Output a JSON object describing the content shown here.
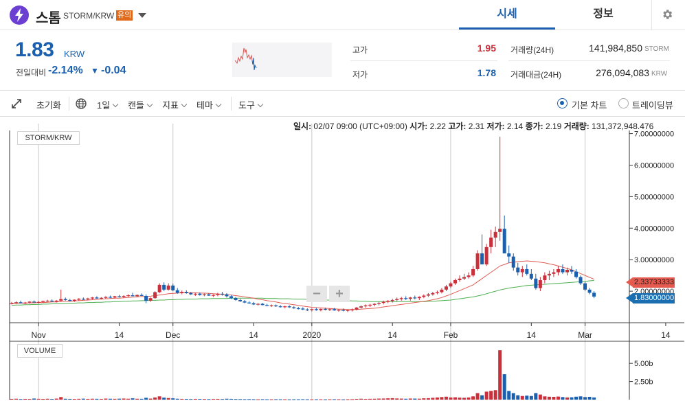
{
  "coin": {
    "name": "스톰",
    "pair": "STORM/KRW",
    "warning_badge": "유의"
  },
  "tabs": {
    "price": "시세",
    "info": "정보"
  },
  "summary": {
    "price": "1.83",
    "price_unit": "KRW",
    "change_label": "전일대비",
    "change_rate": "-2.14%",
    "change_arrow": "▼",
    "change_amount": "-0.04",
    "high_label": "고가",
    "high_value": "1.95",
    "low_label": "저가",
    "low_value": "1.78",
    "volume_label": "거래량(24H)",
    "volume_value": "141,984,850",
    "volume_unit": "STORM",
    "amount_label": "거래대금(24H)",
    "amount_value": "276,094,083",
    "amount_unit": "KRW"
  },
  "toolbar": {
    "reset": "초기화",
    "interval": "1일",
    "candle": "캔들",
    "indicator": "지표",
    "theme": "테마",
    "tools": "도구",
    "basic_chart": "기본 차트",
    "trading_view": "트레이딩뷰"
  },
  "ohlc": {
    "time_label": "일시:",
    "time_value": "02/07 09:00 (UTC+09:00)",
    "open_label": "시가:",
    "open_value": "2.22",
    "high_label": "고가:",
    "high_value": "2.31",
    "low_label": "저가:",
    "low_value": "2.14",
    "close_label": "종가:",
    "close_value": "2.19",
    "volume_label": "거래량:",
    "volume_value": "131,372,948.476"
  },
  "chart_labels": {
    "pair_label": "STORM/KRW",
    "volume_label": "VOLUME",
    "zoom_out": "−",
    "zoom_in": "+",
    "ma_tag": "2.33733333",
    "price_tag": "1.83000000"
  },
  "chart_data": {
    "type": "candlestick",
    "y_ticks": [
      "7.00000000",
      "6.00000000",
      "5.00000000",
      "4.00000000",
      "3.00000000",
      "2.00000000"
    ],
    "y_tick_values": [
      7,
      6,
      5,
      4,
      3,
      2
    ],
    "ylim": [
      1.0,
      7.1
    ],
    "x_tick_labels": [
      "Nov",
      "14",
      "Dec",
      "14",
      "2020",
      "14",
      "Feb",
      "14",
      "Mar",
      "14"
    ],
    "x_tick_days": [
      6,
      24,
      36,
      54,
      67,
      85,
      98,
      116,
      128,
      146
    ],
    "volume_ticks": [
      "5.00b",
      "2.50b"
    ],
    "volume_tick_values": [
      5.0,
      2.5
    ],
    "colors": {
      "up": "#c8303b",
      "down": "#1b5faf",
      "ma_short": "#e05b52",
      "ma_long": "#4caf50"
    },
    "candles": [
      [
        1.61,
        1.66,
        1.58,
        1.63
      ],
      [
        1.63,
        1.68,
        1.6,
        1.65
      ],
      [
        1.65,
        1.7,
        1.62,
        1.62
      ],
      [
        1.62,
        1.66,
        1.59,
        1.64
      ],
      [
        1.64,
        1.68,
        1.61,
        1.67
      ],
      [
        1.67,
        1.71,
        1.64,
        1.64
      ],
      [
        1.64,
        1.69,
        1.61,
        1.66
      ],
      [
        1.66,
        1.7,
        1.63,
        1.69
      ],
      [
        1.69,
        1.73,
        1.66,
        1.7
      ],
      [
        1.7,
        1.74,
        1.66,
        1.67
      ],
      [
        1.67,
        1.72,
        1.64,
        1.7
      ],
      [
        1.7,
        2.05,
        1.67,
        1.75
      ],
      [
        1.75,
        1.8,
        1.7,
        1.72
      ],
      [
        1.72,
        1.76,
        1.68,
        1.69
      ],
      [
        1.69,
        1.74,
        1.66,
        1.73
      ],
      [
        1.73,
        1.78,
        1.7,
        1.76
      ],
      [
        1.76,
        1.8,
        1.72,
        1.74
      ],
      [
        1.74,
        1.79,
        1.71,
        1.77
      ],
      [
        1.77,
        1.82,
        1.74,
        1.8
      ],
      [
        1.8,
        1.84,
        1.76,
        1.77
      ],
      [
        1.77,
        1.81,
        1.74,
        1.79
      ],
      [
        1.79,
        1.84,
        1.76,
        1.82
      ],
      [
        1.82,
        1.86,
        1.78,
        1.8
      ],
      [
        1.8,
        1.85,
        1.77,
        1.84
      ],
      [
        1.84,
        1.88,
        1.8,
        1.82
      ],
      [
        1.82,
        1.87,
        1.79,
        1.85
      ],
      [
        1.85,
        1.9,
        1.82,
        1.87
      ],
      [
        1.87,
        1.95,
        1.84,
        1.84
      ],
      [
        1.84,
        1.9,
        1.81,
        1.88
      ],
      [
        1.88,
        1.93,
        1.85,
        1.85
      ],
      [
        1.85,
        1.9,
        1.62,
        1.7
      ],
      [
        1.7,
        1.8,
        1.66,
        1.78
      ],
      [
        1.78,
        2.0,
        1.76,
        1.97
      ],
      [
        1.97,
        2.25,
        1.94,
        2.2
      ],
      [
        2.2,
        2.28,
        2.0,
        2.05
      ],
      [
        2.05,
        2.25,
        2.02,
        2.18
      ],
      [
        2.18,
        2.24,
        2.0,
        2.03
      ],
      [
        2.03,
        2.1,
        1.92,
        1.95
      ],
      [
        1.95,
        2.02,
        1.9,
        1.98
      ],
      [
        1.98,
        2.03,
        1.92,
        1.94
      ],
      [
        1.94,
        1.98,
        1.88,
        1.9
      ],
      [
        1.9,
        1.95,
        1.85,
        1.92
      ],
      [
        1.92,
        1.96,
        1.86,
        1.88
      ],
      [
        1.88,
        1.93,
        1.84,
        1.9
      ],
      [
        1.9,
        1.94,
        1.85,
        1.86
      ],
      [
        1.86,
        1.9,
        1.82,
        1.88
      ],
      [
        1.88,
        1.95,
        1.84,
        1.92
      ],
      [
        1.92,
        1.98,
        1.86,
        1.9
      ],
      [
        1.9,
        1.94,
        1.8,
        1.84
      ],
      [
        1.84,
        1.88,
        1.75,
        1.78
      ],
      [
        1.78,
        1.82,
        1.7,
        1.72
      ],
      [
        1.72,
        1.76,
        1.66,
        1.68
      ],
      [
        1.68,
        1.72,
        1.62,
        1.64
      ],
      [
        1.64,
        1.68,
        1.6,
        1.62
      ],
      [
        1.62,
        1.66,
        1.56,
        1.58
      ],
      [
        1.58,
        1.62,
        1.54,
        1.6
      ],
      [
        1.6,
        1.63,
        1.55,
        1.56
      ],
      [
        1.56,
        1.6,
        1.52,
        1.54
      ],
      [
        1.54,
        1.58,
        1.5,
        1.55
      ],
      [
        1.55,
        1.58,
        1.5,
        1.52
      ],
      [
        1.52,
        1.56,
        1.48,
        1.5
      ],
      [
        1.5,
        1.54,
        1.46,
        1.52
      ],
      [
        1.52,
        1.55,
        1.47,
        1.49
      ],
      [
        1.49,
        1.53,
        1.44,
        1.46
      ],
      [
        1.46,
        1.5,
        1.42,
        1.45
      ],
      [
        1.45,
        1.49,
        1.4,
        1.42
      ],
      [
        1.42,
        1.46,
        1.37,
        1.4
      ],
      [
        1.4,
        1.45,
        1.36,
        1.43
      ],
      [
        1.43,
        1.47,
        1.38,
        1.4
      ],
      [
        1.4,
        1.45,
        1.36,
        1.44
      ],
      [
        1.44,
        1.48,
        1.39,
        1.41
      ],
      [
        1.41,
        1.45,
        1.37,
        1.43
      ],
      [
        1.43,
        1.47,
        1.38,
        1.39
      ],
      [
        1.39,
        1.43,
        1.35,
        1.41
      ],
      [
        1.41,
        1.45,
        1.36,
        1.38
      ],
      [
        1.38,
        1.42,
        1.34,
        1.4
      ],
      [
        1.4,
        1.45,
        1.36,
        1.42
      ],
      [
        1.42,
        1.5,
        1.39,
        1.48
      ],
      [
        1.48,
        1.55,
        1.45,
        1.52
      ],
      [
        1.52,
        1.58,
        1.48,
        1.55
      ],
      [
        1.55,
        1.6,
        1.5,
        1.57
      ],
      [
        1.57,
        1.62,
        1.52,
        1.6
      ],
      [
        1.6,
        1.66,
        1.55,
        1.63
      ],
      [
        1.63,
        1.7,
        1.58,
        1.66
      ],
      [
        1.66,
        1.72,
        1.62,
        1.69
      ],
      [
        1.69,
        1.76,
        1.64,
        1.72
      ],
      [
        1.72,
        1.8,
        1.68,
        1.75
      ],
      [
        1.75,
        1.82,
        1.7,
        1.78
      ],
      [
        1.78,
        1.84,
        1.72,
        1.76
      ],
      [
        1.76,
        1.82,
        1.7,
        1.8
      ],
      [
        1.8,
        1.86,
        1.74,
        1.78
      ],
      [
        1.78,
        1.84,
        1.72,
        1.82
      ],
      [
        1.82,
        1.9,
        1.78,
        1.86
      ],
      [
        1.86,
        1.94,
        1.82,
        1.9
      ],
      [
        1.9,
        1.98,
        1.86,
        1.94
      ],
      [
        1.94,
        2.02,
        1.9,
        1.97
      ],
      [
        1.97,
        2.1,
        1.93,
        2.05
      ],
      [
        2.05,
        2.2,
        2.0,
        2.15
      ],
      [
        2.15,
        2.3,
        2.1,
        2.25
      ],
      [
        2.25,
        2.4,
        2.2,
        2.35
      ],
      [
        2.35,
        2.5,
        2.3,
        2.4
      ],
      [
        2.4,
        2.55,
        2.35,
        2.45
      ],
      [
        2.45,
        2.6,
        2.4,
        2.5
      ],
      [
        2.5,
        2.8,
        2.45,
        2.7
      ],
      [
        2.7,
        3.3,
        2.65,
        3.2
      ],
      [
        3.2,
        3.8,
        2.9,
        2.85
      ],
      [
        2.85,
        3.5,
        2.8,
        3.4
      ],
      [
        3.4,
        3.95,
        3.2,
        3.7
      ],
      [
        3.7,
        4.05,
        3.4,
        3.88
      ],
      [
        3.88,
        6.9,
        3.6,
        3.98
      ],
      [
        3.98,
        4.4,
        3.2,
        3.2
      ],
      [
        3.2,
        3.45,
        2.9,
        3.1
      ],
      [
        3.1,
        3.2,
        2.65,
        2.75
      ],
      [
        2.75,
        2.9,
        2.5,
        2.6
      ],
      [
        2.6,
        2.8,
        2.45,
        2.7
      ],
      [
        2.7,
        2.85,
        2.5,
        2.55
      ],
      [
        2.55,
        2.7,
        2.35,
        2.4
      ],
      [
        2.4,
        2.55,
        2.05,
        2.1
      ],
      [
        2.1,
        2.45,
        2.0,
        2.35
      ],
      [
        2.35,
        2.6,
        2.25,
        2.5
      ],
      [
        2.5,
        2.65,
        2.35,
        2.55
      ],
      [
        2.55,
        2.7,
        2.45,
        2.6
      ],
      [
        2.6,
        2.8,
        2.5,
        2.7
      ],
      [
        2.7,
        2.85,
        2.55,
        2.6
      ],
      [
        2.6,
        2.75,
        2.5,
        2.68
      ],
      [
        2.68,
        2.8,
        2.55,
        2.62
      ],
      [
        2.62,
        2.7,
        2.4,
        2.45
      ],
      [
        2.45,
        2.5,
        2.2,
        2.25
      ],
      [
        2.25,
        2.3,
        2.0,
        2.05
      ],
      [
        2.05,
        2.1,
        1.9,
        1.95
      ],
      [
        1.95,
        2.0,
        1.78,
        1.83
      ]
    ],
    "volume": [
      0.1,
      0.12,
      0.08,
      0.1,
      0.09,
      0.15,
      0.11,
      0.1,
      0.12,
      0.09,
      0.14,
      0.35,
      0.12,
      0.1,
      0.09,
      0.11,
      0.13,
      0.1,
      0.12,
      0.11,
      0.1,
      0.14,
      0.12,
      0.11,
      0.13,
      0.15,
      0.12,
      0.18,
      0.12,
      0.11,
      0.25,
      0.14,
      0.3,
      0.45,
      0.28,
      0.22,
      0.18,
      0.12,
      0.1,
      0.09,
      0.08,
      0.1,
      0.09,
      0.08,
      0.07,
      0.09,
      0.1,
      0.08,
      0.12,
      0.1,
      0.08,
      0.07,
      0.06,
      0.07,
      0.06,
      0.05,
      0.06,
      0.05,
      0.05,
      0.06,
      0.05,
      0.05,
      0.04,
      0.05,
      0.05,
      0.06,
      0.05,
      0.04,
      0.05,
      0.05,
      0.04,
      0.05,
      0.06,
      0.05,
      0.04,
      0.05,
      0.06,
      0.1,
      0.12,
      0.1,
      0.11,
      0.12,
      0.14,
      0.15,
      0.18,
      0.2,
      0.16,
      0.14,
      0.12,
      0.15,
      0.14,
      0.13,
      0.18,
      0.2,
      0.25,
      0.3,
      0.35,
      0.4,
      0.3,
      0.32,
      0.28,
      0.25,
      0.3,
      0.45,
      0.9,
      0.6,
      1.1,
      1.2,
      1.3,
      6.8,
      3.5,
      1.2,
      0.9,
      0.6,
      0.5,
      0.55,
      0.5,
      0.9,
      0.7,
      0.45,
      0.4,
      0.38,
      0.42,
      0.35,
      0.3,
      0.32,
      0.4,
      0.45,
      0.35,
      0.38,
      0.3
    ],
    "ma_short": [
      1.6,
      1.61,
      1.62,
      1.62,
      1.63,
      1.63,
      1.64,
      1.64,
      1.65,
      1.66,
      1.66,
      1.67,
      1.68,
      1.68,
      1.69,
      1.7,
      1.71,
      1.72,
      1.73,
      1.74,
      1.75,
      1.76,
      1.77,
      1.78,
      1.78,
      1.79,
      1.8,
      1.81,
      1.82,
      1.83,
      1.83,
      1.84,
      1.86,
      1.88,
      1.9,
      1.92,
      1.93,
      1.94,
      1.95,
      1.95,
      1.95,
      1.95,
      1.94,
      1.94,
      1.93,
      1.92,
      1.91,
      1.9,
      1.89,
      1.88,
      1.86,
      1.84,
      1.82,
      1.8,
      1.78,
      1.75,
      1.73,
      1.7,
      1.68,
      1.66,
      1.63,
      1.61,
      1.59,
      1.57,
      1.55,
      1.53,
      1.51,
      1.49,
      1.48,
      1.47,
      1.46,
      1.45,
      1.44,
      1.43,
      1.43,
      1.42,
      1.42,
      1.42,
      1.43,
      1.44,
      1.45,
      1.46,
      1.48,
      1.5,
      1.52,
      1.54,
      1.56,
      1.58,
      1.6,
      1.62,
      1.64,
      1.66,
      1.68,
      1.7,
      1.73,
      1.76,
      1.8,
      1.85,
      1.9,
      1.96,
      2.02,
      2.08,
      2.14,
      2.2,
      2.3,
      2.4,
      2.5,
      2.6,
      2.7,
      2.8,
      2.85,
      2.9,
      2.92,
      2.94,
      2.95,
      2.96,
      2.95,
      2.94,
      2.92,
      2.9,
      2.87,
      2.84,
      2.8,
      2.76,
      2.72,
      2.68,
      2.62,
      2.56,
      2.5,
      2.44,
      2.38
    ],
    "ma_long": [
      1.55,
      1.56,
      1.56,
      1.57,
      1.57,
      1.58,
      1.58,
      1.59,
      1.59,
      1.6,
      1.6,
      1.61,
      1.61,
      1.62,
      1.62,
      1.63,
      1.63,
      1.64,
      1.64,
      1.65,
      1.65,
      1.66,
      1.66,
      1.67,
      1.67,
      1.68,
      1.68,
      1.69,
      1.69,
      1.7,
      1.7,
      1.71,
      1.71,
      1.72,
      1.72,
      1.73,
      1.73,
      1.74,
      1.74,
      1.75,
      1.75,
      1.75,
      1.76,
      1.76,
      1.76,
      1.77,
      1.77,
      1.77,
      1.77,
      1.78,
      1.78,
      1.78,
      1.78,
      1.78,
      1.78,
      1.78,
      1.78,
      1.77,
      1.77,
      1.77,
      1.76,
      1.76,
      1.76,
      1.75,
      1.75,
      1.75,
      1.74,
      1.74,
      1.73,
      1.73,
      1.72,
      1.72,
      1.71,
      1.71,
      1.7,
      1.7,
      1.69,
      1.69,
      1.68,
      1.68,
      1.67,
      1.67,
      1.67,
      1.67,
      1.67,
      1.67,
      1.67,
      1.67,
      1.67,
      1.67,
      1.67,
      1.67,
      1.67,
      1.68,
      1.68,
      1.69,
      1.7,
      1.71,
      1.72,
      1.74,
      1.76,
      1.78,
      1.8,
      1.82,
      1.85,
      1.88,
      1.92,
      1.96,
      2.0,
      2.04,
      2.07,
      2.1,
      2.12,
      2.14,
      2.16,
      2.18,
      2.19,
      2.2,
      2.21,
      2.22,
      2.23,
      2.24,
      2.25,
      2.26,
      2.27,
      2.28,
      2.29,
      2.3,
      2.31,
      2.33,
      2.34
    ]
  }
}
